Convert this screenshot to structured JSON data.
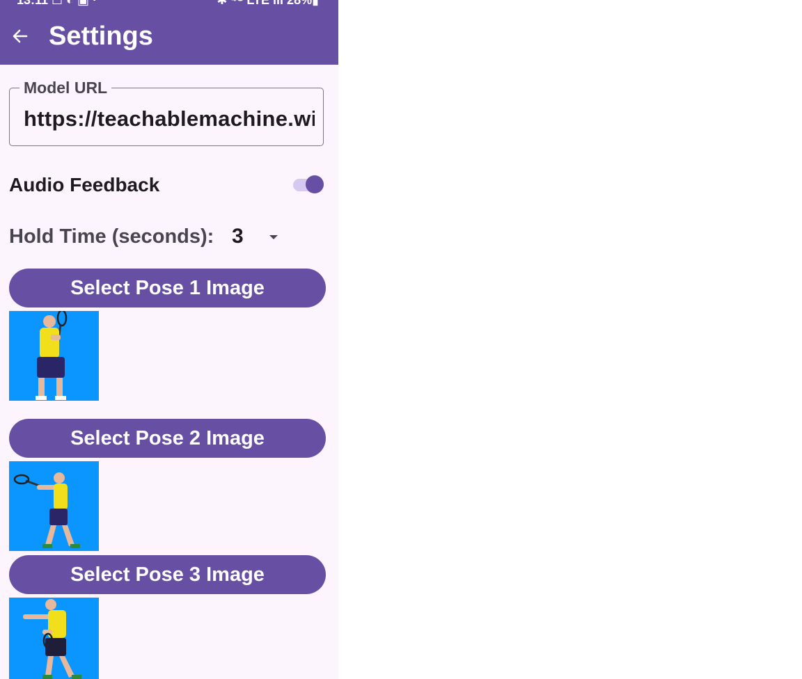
{
  "status_bar": {
    "left_text": "13:11 ☐ ◐ ▣ ·",
    "right_text": "✱ ⁴ᴳ LTE ıll 28%▮"
  },
  "app_bar": {
    "title": "Settings",
    "back_icon": "arrow-back-icon",
    "background": "#6750a4"
  },
  "model_url": {
    "label": "Model URL",
    "value": "https://teachablemachine.withgoogle.com/"
  },
  "audio_feedback": {
    "label": "Audio Feedback",
    "enabled": true
  },
  "hold_time": {
    "label": "Hold Time (seconds):",
    "value": "3",
    "dropdown_icon": "arrow-drop-down-icon"
  },
  "poses": [
    {
      "button_label": "Select Pose 1 Image",
      "image_alt": "tennis-player-pose-1"
    },
    {
      "button_label": "Select Pose 2 Image",
      "image_alt": "tennis-player-pose-2"
    },
    {
      "button_label": "Select Pose 3 Image",
      "image_alt": "tennis-player-pose-3"
    }
  ],
  "colors": {
    "primary": "#6750a4",
    "surface": "#fcf5fd",
    "pose_background": "#0a95ff"
  }
}
